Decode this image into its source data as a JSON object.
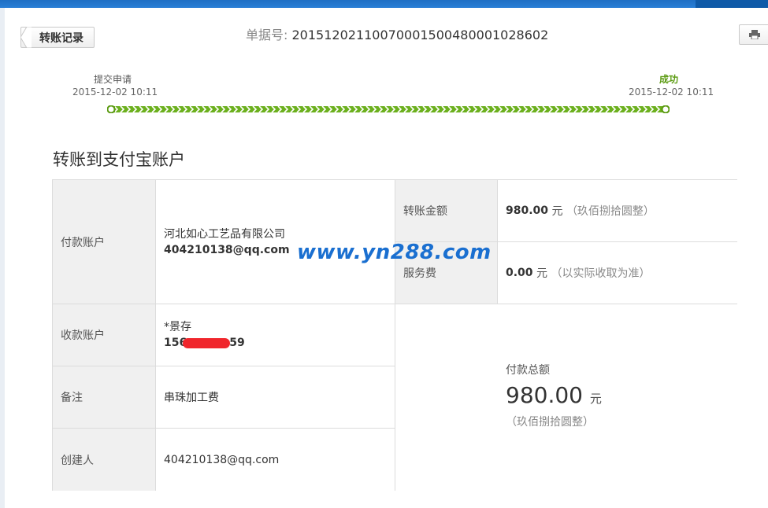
{
  "header": {
    "back_label": "转账记录",
    "doc_no_label": "单据号:",
    "doc_no_value": "2015120211007000150048000102860​2"
  },
  "progress": {
    "steps": [
      {
        "name": "提交申请",
        "time": "2015-12-02 10:11"
      },
      {
        "name": "成功",
        "time": "2015-12-02 10:11"
      }
    ],
    "accent": "#5a9a10"
  },
  "section_title": "转账到支付宝账户",
  "details": {
    "payer_label": "付款账户",
    "payer_name": "河北如心工艺品有限公司",
    "payer_account": "404210138@qq.com",
    "payee_label": "收款账户",
    "payee_name": "*景存",
    "payee_account_start": "156",
    "payee_account_end": "59",
    "remark_label": "备注",
    "remark_value": "串珠加工费",
    "creator_label": "创建人",
    "creator_value": "404210138@qq.com",
    "amount_label": "转账金额",
    "amount_value": "980.00",
    "amount_unit": "元",
    "amount_words": "（玖佰捌拾圆整）",
    "fee_label": "服务费",
    "fee_value": "0.00",
    "fee_unit": "元",
    "fee_note": "（以实际收取为准）",
    "total_label": "付款总额",
    "total_value": "980.00",
    "total_unit": "元",
    "total_words": "（玖佰捌拾圆整）"
  },
  "watermark": "www.yn288.com"
}
